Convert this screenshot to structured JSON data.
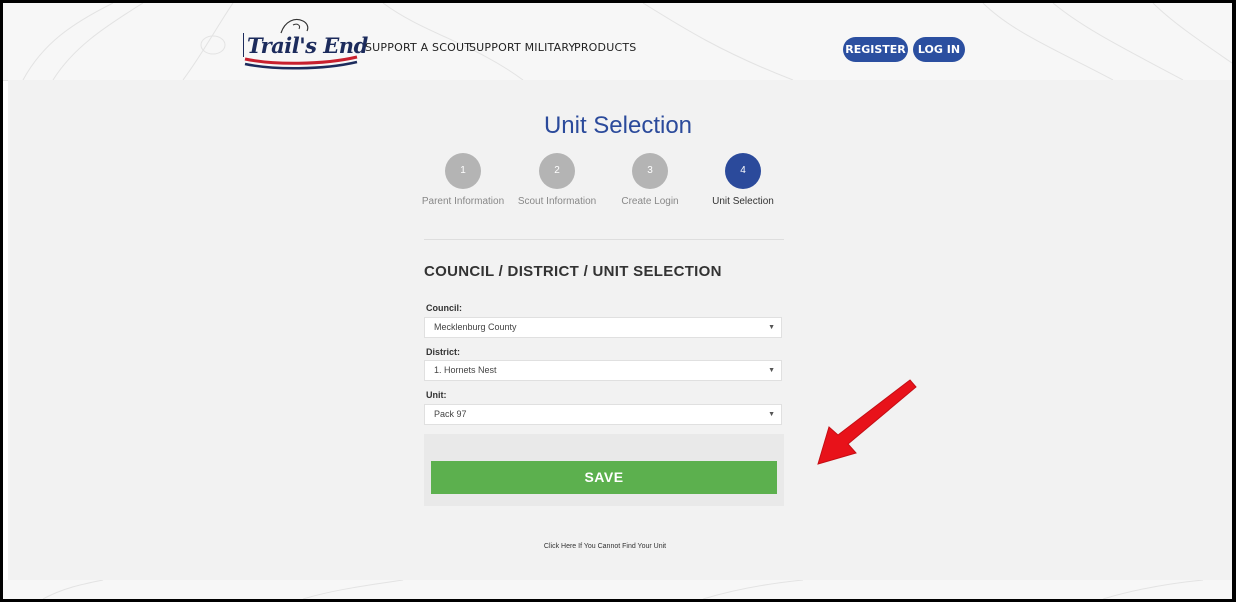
{
  "header": {
    "logo_text": "Trail's End",
    "nav": [
      "SUPPORT A SCOUT",
      "SUPPORT MILITARY",
      "PRODUCTS"
    ],
    "register_label": "REGISTER",
    "login_label": "LOG IN",
    "brand_color": "#2b4fa0"
  },
  "page": {
    "title": "Unit Selection",
    "steps": [
      {
        "number": "1",
        "label": "Parent Information",
        "active": false
      },
      {
        "number": "2",
        "label": "Scout Information",
        "active": false
      },
      {
        "number": "3",
        "label": "Create Login",
        "active": false
      },
      {
        "number": "4",
        "label": "Unit Selection",
        "active": true
      }
    ],
    "section_heading": "COUNCIL / DISTRICT / UNIT SELECTION",
    "fields": {
      "council_label": "Council:",
      "council_value": "Mecklenburg County",
      "district_label": "District:",
      "district_value": "1. Hornets Nest",
      "unit_label": "Unit:",
      "unit_value": "Pack 97"
    },
    "save_label": "SAVE",
    "cant_find_link": "Click Here If You Cannot Find Your Unit"
  },
  "colors": {
    "accent": "#2b4a9b",
    "save_green": "#5cb04e",
    "annotation_arrow": "#e8121a"
  }
}
